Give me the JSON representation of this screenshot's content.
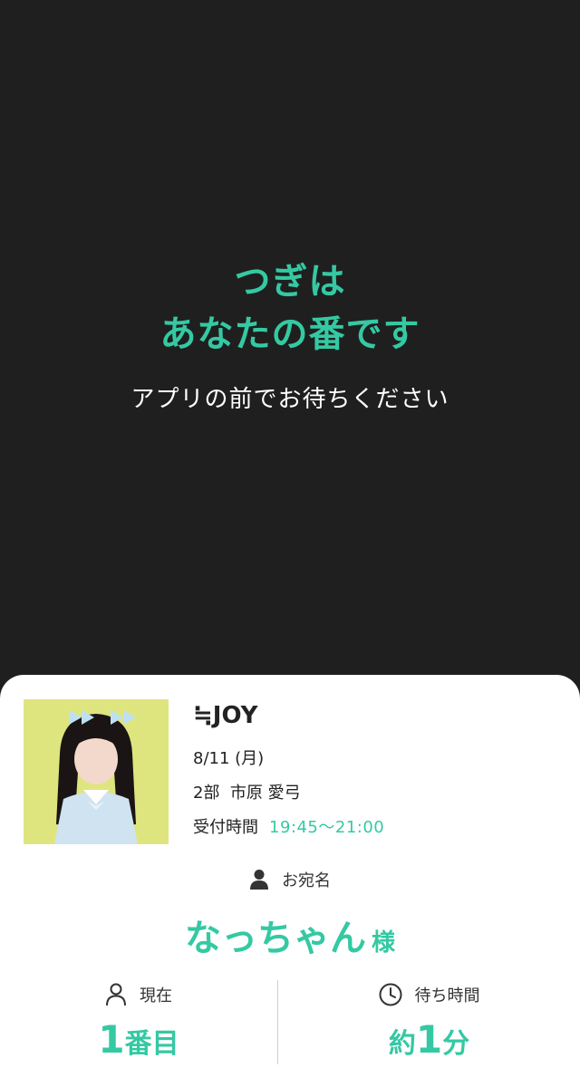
{
  "hero": {
    "title_line1": "つぎは",
    "title_line2": "あなたの番です",
    "subtitle": "アプリの前でお待ちください"
  },
  "ticket": {
    "group": "≒JOY",
    "date": "8/11 (月)",
    "session": "2部",
    "member": "市原 愛弓",
    "time_label": "受付時間",
    "time_value": "19:45〜21:00",
    "address_label": "お宛名",
    "name": "なっちゃん",
    "honorific": "様",
    "current_label": "現在",
    "current_number": "1",
    "current_suffix": "番目",
    "wait_label": "待ち時間",
    "wait_prefix": "約",
    "wait_number": "1",
    "wait_suffix": "分"
  },
  "colors": {
    "accent": "#34c9a3",
    "background": "#1f1f1f",
    "card": "#ffffff"
  },
  "icons": [
    "person-icon",
    "person-outline-icon",
    "clock-icon"
  ]
}
